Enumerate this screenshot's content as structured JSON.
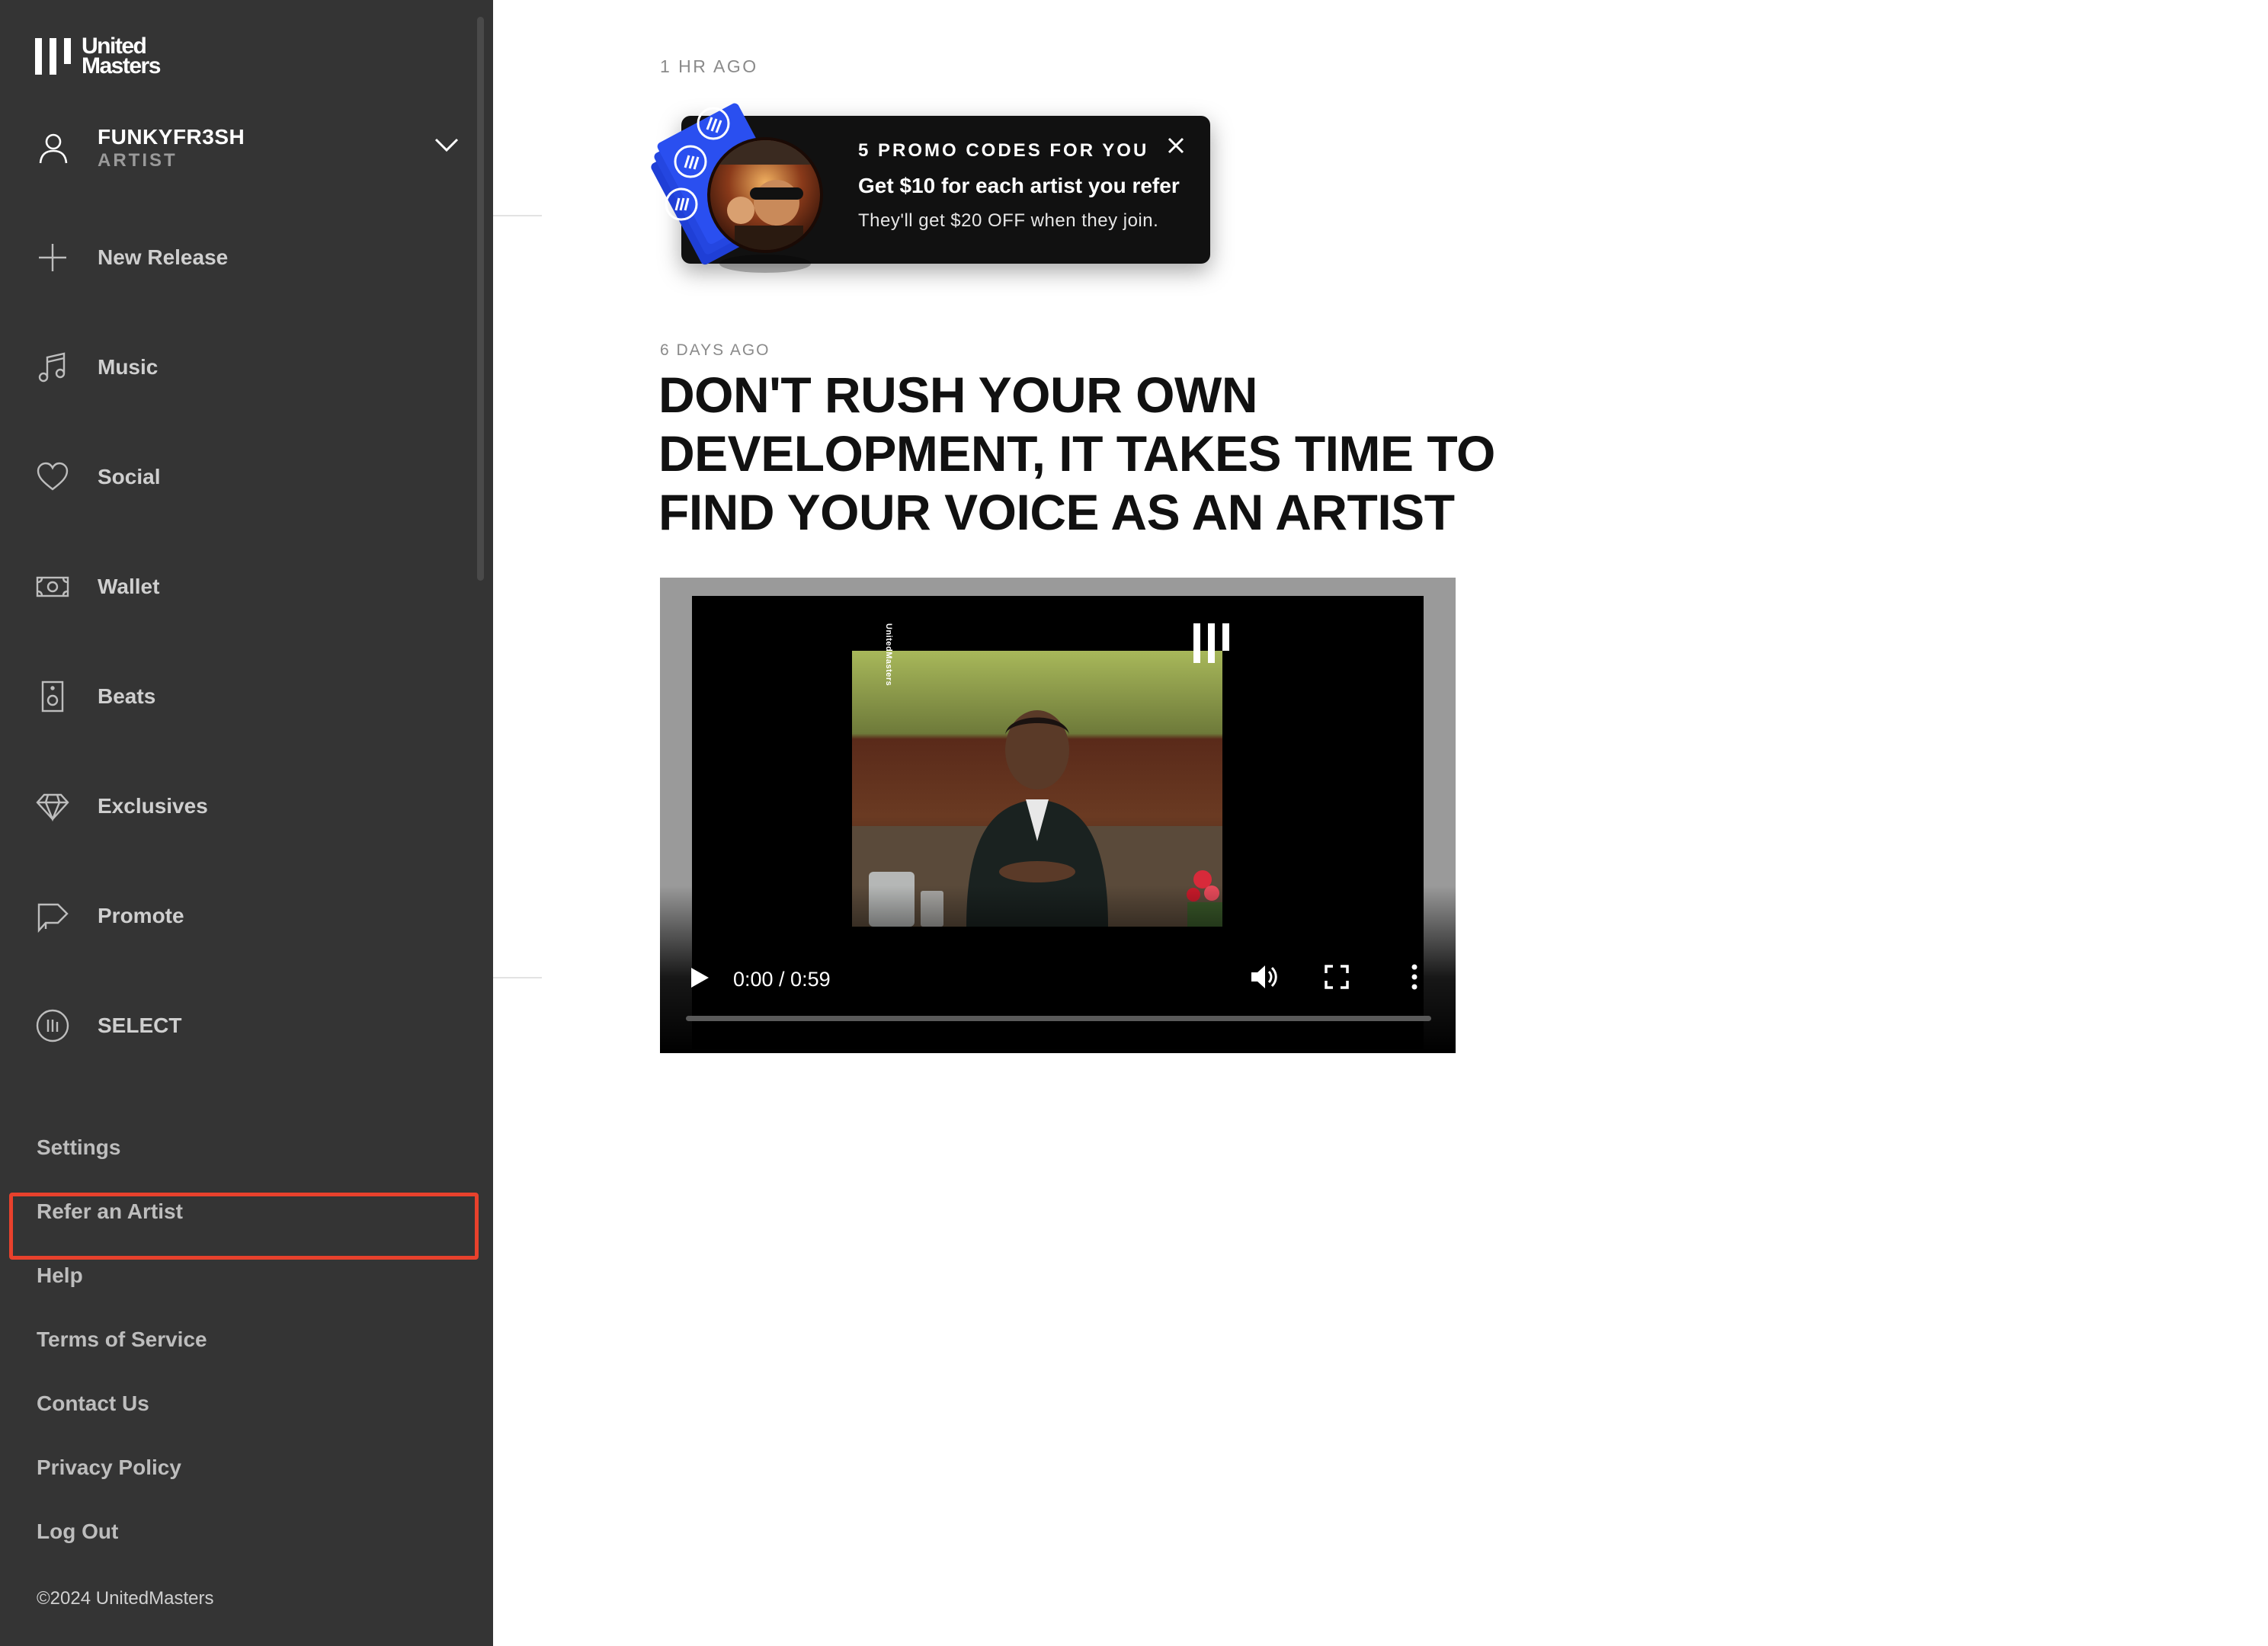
{
  "sidebar": {
    "logo_text_line1": "United",
    "logo_text_line2": "Masters",
    "account": {
      "name": "FUNKYFR3SH",
      "role": "ARTIST"
    },
    "nav": [
      {
        "label": "New Release",
        "icon": "plus-icon"
      },
      {
        "label": "Music",
        "icon": "music-note-icon"
      },
      {
        "label": "Social",
        "icon": "heart-icon"
      },
      {
        "label": "Wallet",
        "icon": "cash-icon"
      },
      {
        "label": "Beats",
        "icon": "speaker-icon"
      },
      {
        "label": "Exclusives",
        "icon": "diamond-icon"
      },
      {
        "label": "Promote",
        "icon": "megaphone-icon"
      },
      {
        "label": "SELECT",
        "icon": "select-badge-icon"
      }
    ],
    "footer_links": [
      "Settings",
      "Refer an Artist",
      "Help",
      "Terms of Service",
      "Contact Us",
      "Privacy Policy",
      "Log Out"
    ],
    "highlighted_link": "Refer an Artist",
    "copyright": "©2024 UnitedMasters"
  },
  "feed": {
    "promo": {
      "timestamp": "1 HR AGO",
      "title": "5 PROMO CODES FOR YOU",
      "headline": "Get $10 for each artist you refer",
      "subtext": "They'll get $20 OFF when they join."
    },
    "post": {
      "timestamp": "6 DAYS AGO",
      "headline_lines": [
        "DON'T RUSH YOUR OWN",
        "DEVELOPMENT, IT TAKES TIME TO",
        "FIND YOUR VOICE AS AN ARTIST"
      ],
      "video": {
        "time": "0:00 / 0:59",
        "progress": 0,
        "side_brand": "UnitedMasters"
      }
    }
  },
  "colors": {
    "sidebar_bg": "#343434",
    "highlight": "#e8412c",
    "promo_bg": "#111111",
    "ticket_blue": "#1f3fd6"
  }
}
